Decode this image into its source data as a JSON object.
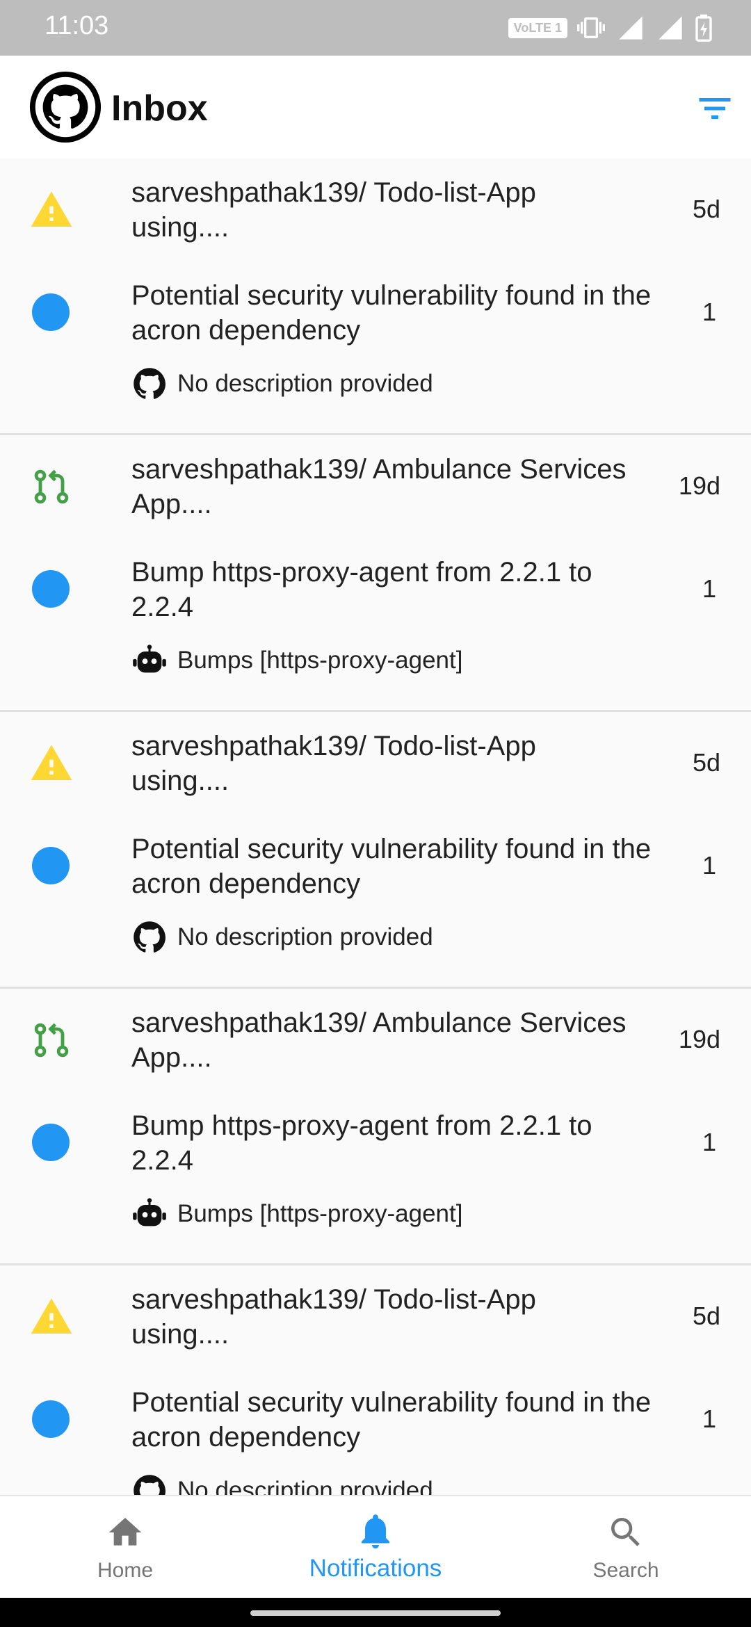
{
  "status_bar": {
    "time": "11:03",
    "volte": "VoLTE 1",
    "network": "4G"
  },
  "app_bar": {
    "title": "Inbox",
    "logo_icon": "github-logo-icon",
    "filter_icon": "filter-icon"
  },
  "notifications": [
    {
      "type": "warning",
      "repo": "sarveshpathak139/ Todo-list-App using....",
      "age": "5d",
      "subject": "Potential security vulnerability found in the acron dependency",
      "count": "1",
      "description": "No description provided",
      "desc_icon": "github-icon"
    },
    {
      "type": "pull-request",
      "repo": "sarveshpathak139/ Ambulance Services App....",
      "age": "19d",
      "subject": "Bump https-proxy-agent from 2.2.1 to 2.2.4",
      "count": "1",
      "description": "Bumps [https-proxy-agent]",
      "desc_icon": "robot-icon"
    },
    {
      "type": "warning",
      "repo": "sarveshpathak139/ Todo-list-App using....",
      "age": "5d",
      "subject": "Potential security vulnerability found in the acron dependency",
      "count": "1",
      "description": "No description provided",
      "desc_icon": "github-icon"
    },
    {
      "type": "pull-request",
      "repo": "sarveshpathak139/ Ambulance Services App....",
      "age": "19d",
      "subject": "Bump https-proxy-agent from 2.2.1 to 2.2.4",
      "count": "1",
      "description": "Bumps [https-proxy-agent]",
      "desc_icon": "robot-icon"
    },
    {
      "type": "warning",
      "repo": "sarveshpathak139/ Todo-list-App using....",
      "age": "5d",
      "subject": "Potential security vulnerability found in the acron dependency",
      "count": "1",
      "description": "No description provided",
      "desc_icon": "github-icon"
    }
  ],
  "bottom_nav": {
    "home": "Home",
    "notifications": "Notifications",
    "search": "Search",
    "active": "notifications"
  },
  "colors": {
    "accent": "#2196f3",
    "warning": "#fdd835",
    "pr_green": "#43a047",
    "inactive": "#757575"
  }
}
